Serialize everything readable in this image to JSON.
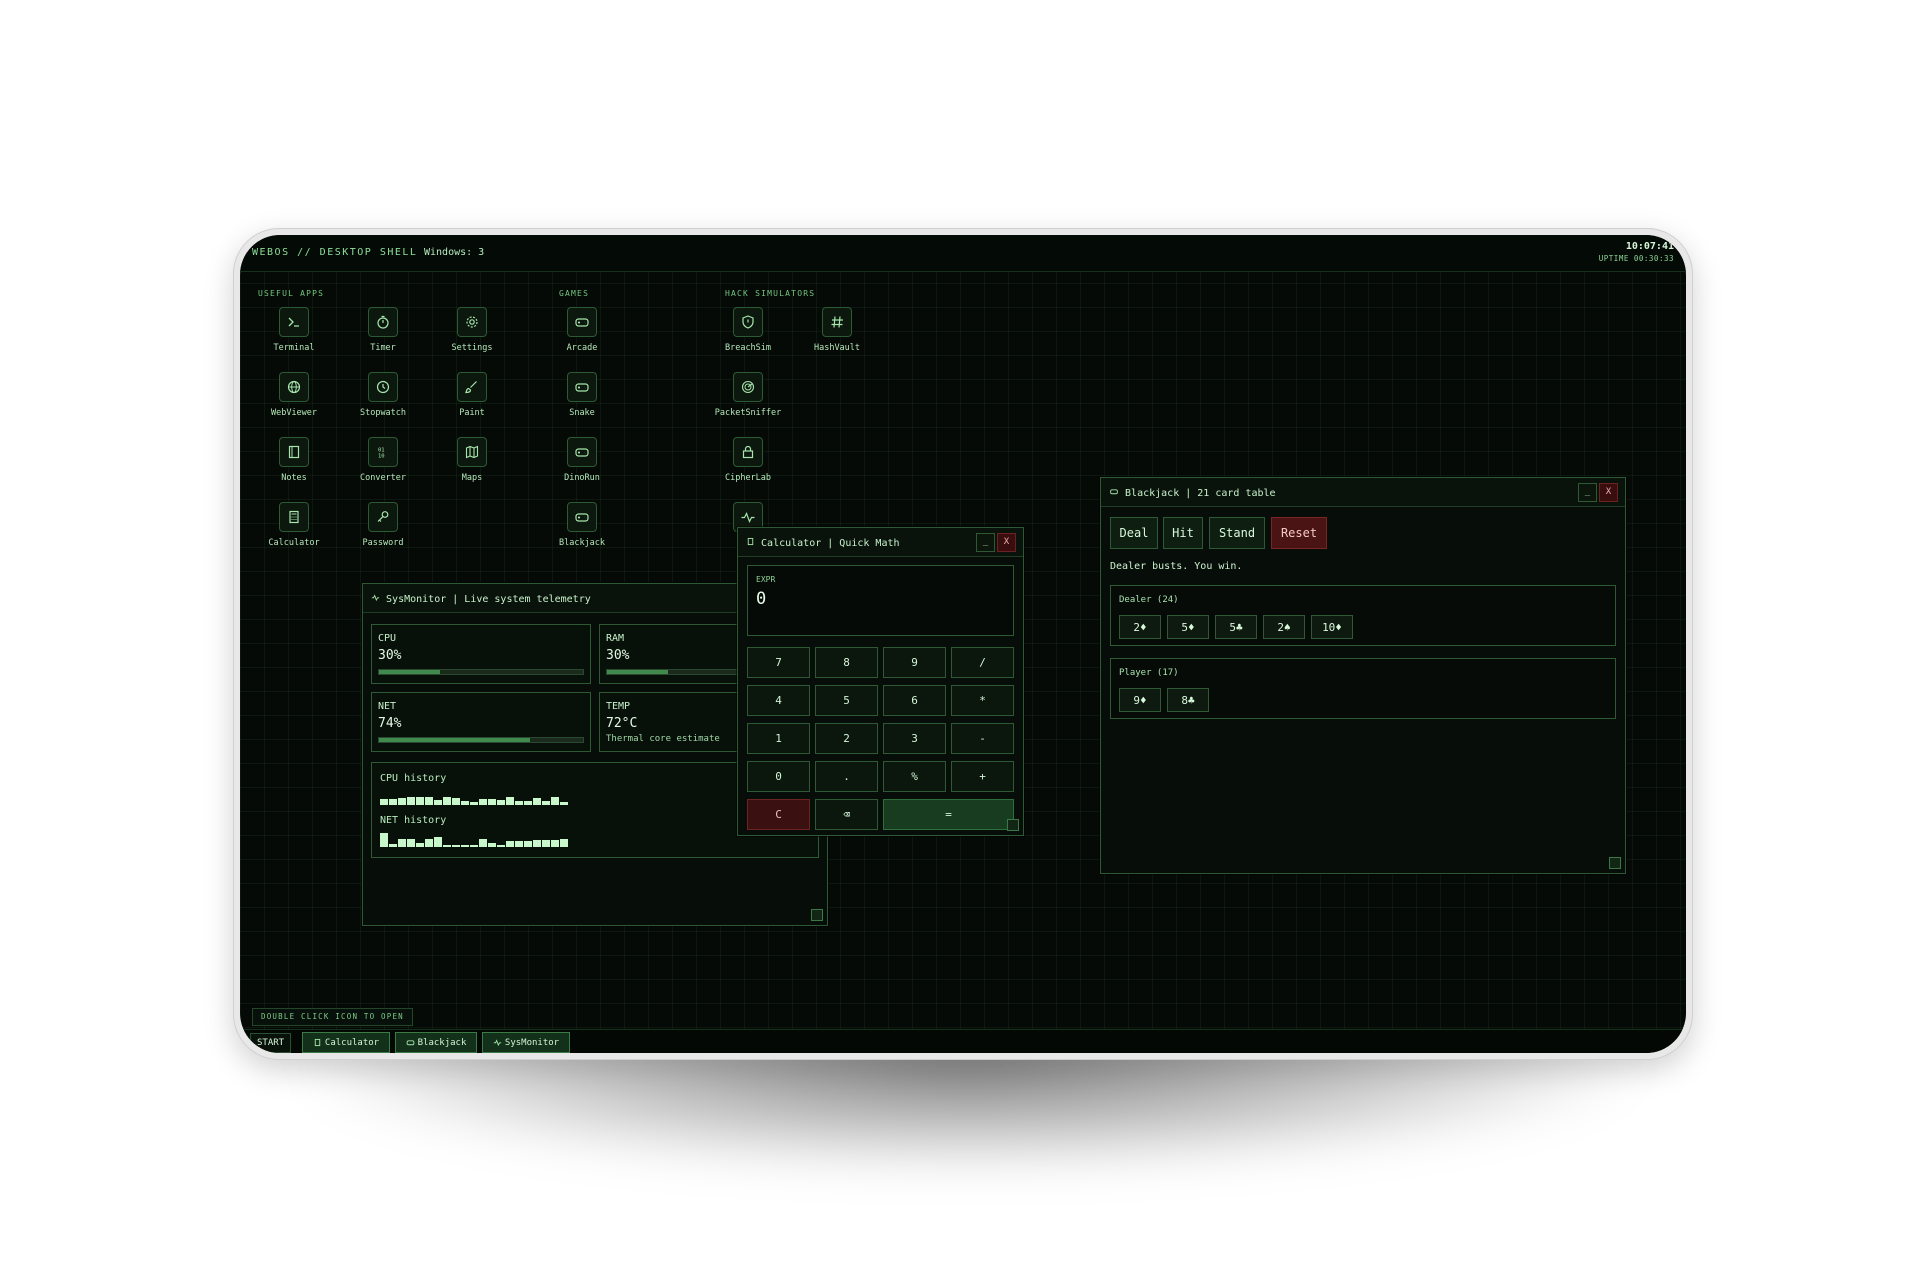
{
  "topbar": {
    "brand": "WEBOS // DESKTOP SHELL",
    "windows": "Windows: 3",
    "clock": "10:07:41",
    "uptime": "UPTIME 00:30:33"
  },
  "sections": {
    "useful": "USEFUL APPS",
    "games": "GAMES",
    "hack": "HACK SIMULATORS"
  },
  "icons": {
    "terminal": "Terminal",
    "timer": "Timer",
    "settings": "Settings",
    "webviewer": "WebViewer",
    "stopwatch": "Stopwatch",
    "paint": "Paint",
    "notes": "Notes",
    "converter": "Converter",
    "maps": "Maps",
    "calculator": "Calculator",
    "password": "Password",
    "arcade": "Arcade",
    "snake": "Snake",
    "dinorun": "DinoRun",
    "blackjack": "Blackjack",
    "breachsim": "BreachSim",
    "hashvault": "HashVault",
    "packetsniffer": "PacketSniffer",
    "cipherlab": "CipherLab"
  },
  "sysmonitor": {
    "title": "SysMonitor | Live system telemetry",
    "cpu": {
      "label": "CPU",
      "value": "30%",
      "level": 0.3
    },
    "ram": {
      "label": "RAM",
      "value": "30%",
      "level": 0.3
    },
    "net": {
      "label": "NET",
      "value": "74%",
      "level": 0.74
    },
    "temp": {
      "label": "TEMP",
      "value": "72°C",
      "sub": "Thermal core estimate"
    },
    "cpu_history_label": "CPU history",
    "net_history_label": "NET history",
    "cpu_history": [
      0.45,
      0.45,
      0.5,
      0.6,
      0.6,
      0.55,
      0.35,
      0.55,
      0.5,
      0.3,
      0.2,
      0.4,
      0.45,
      0.35,
      0.6,
      0.3,
      0.3,
      0.5,
      0.25,
      0.55,
      0.2
    ],
    "net_history": [
      1.0,
      0.2,
      0.55,
      0.55,
      0.25,
      0.55,
      0.7,
      0.15,
      0.15,
      0.15,
      0.05,
      0.6,
      0.25,
      0.15,
      0.45,
      0.45,
      0.45,
      0.5,
      0.5,
      0.5,
      0.55
    ]
  },
  "calculator": {
    "title": "Calculator | Quick Math",
    "expr_label": "EXPR",
    "value": "0",
    "keys": [
      "7",
      "8",
      "9",
      "/",
      "4",
      "5",
      "6",
      "*",
      "1",
      "2",
      "3",
      "-",
      "0",
      ".",
      "%",
      "+"
    ],
    "clear": "C",
    "backspace": "⌫",
    "equals": "="
  },
  "blackjack": {
    "title": "Blackjack | 21 card table",
    "deal": "Deal",
    "hit": "Hit",
    "stand": "Stand",
    "reset": "Reset",
    "status": "Dealer busts. You win.",
    "dealer_label": "Dealer (24)",
    "dealer_cards": [
      "2♦",
      "5♦",
      "5♣",
      "2♠",
      "10♦"
    ],
    "player_label": "Player (17)",
    "player_cards": [
      "9♦",
      "8♣"
    ]
  },
  "window_controls": {
    "minimize": "_",
    "close": "X"
  },
  "hint": "DOUBLE CLICK ICON TO OPEN",
  "taskbar": {
    "start": "START",
    "items": [
      "Calculator",
      "Blackjack",
      "SysMonitor"
    ]
  },
  "colors": {
    "accent": "#9fe3a3",
    "background": "#060a07",
    "danger": "#3a0e0e"
  }
}
